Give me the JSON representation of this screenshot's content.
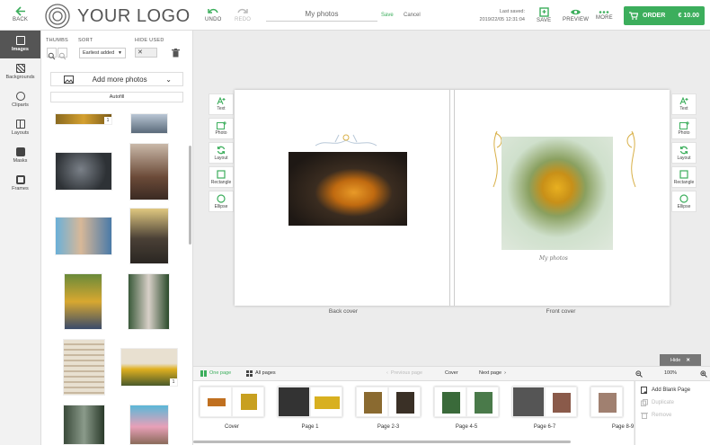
{
  "topbar": {
    "back_label": "BACK",
    "logo_text": "YOUR LOGO",
    "undo_label": "UNDO",
    "redo_label": "REDO",
    "project_title": "My photos",
    "save_link": "Save",
    "cancel_link": "Cancel",
    "last_saved_label": "Last saved:",
    "last_saved_time": "2019/22/05 12:31:04",
    "save_label": "SAVE",
    "preview_label": "PREVIEW",
    "more_label": "MORE",
    "order_label": "ORDER",
    "order_price": "€ 10.00",
    "accent_color": "#3cae5c"
  },
  "leftnav": {
    "items": [
      {
        "label": "Images",
        "icon": "image-icon"
      },
      {
        "label": "Backgrounds",
        "icon": "backgrounds-icon"
      },
      {
        "label": "Cliparts",
        "icon": "cliparts-icon"
      },
      {
        "label": "Layouts",
        "icon": "layouts-icon"
      },
      {
        "label": "Masks",
        "icon": "masks-icon"
      },
      {
        "label": "Frames",
        "icon": "frames-icon"
      }
    ]
  },
  "panel": {
    "thumbs_label": "THUMBS",
    "sort_label": "SORT",
    "sort_value": "Earliest added",
    "hide_used_label": "HIDE USED",
    "add_more_label": "Add more photos",
    "autofill_label": "Autofill",
    "badge_count": "1"
  },
  "tools": [
    "Text",
    "Photo",
    "Layout",
    "Rectangle",
    "Ellipse"
  ],
  "canvas": {
    "back_cover_label": "Back cover",
    "front_cover_label": "Front cover",
    "caption_text": "My photos"
  },
  "bottombar": {
    "hide_label": "Hide",
    "one_page_label": "One page",
    "all_pages_label": "All pages",
    "previous_label": "Previous page",
    "cover_label": "Cover",
    "next_label": "Next page",
    "zoom_value": "100%"
  },
  "pages": [
    "Cover",
    "Page 1",
    "Page 2-3",
    "Page 4-5",
    "Page 6-7",
    "Page 8-9"
  ],
  "context_menu": {
    "add_blank": "Add Blank Page",
    "duplicate": "Duplicate",
    "remove": "Remove"
  }
}
